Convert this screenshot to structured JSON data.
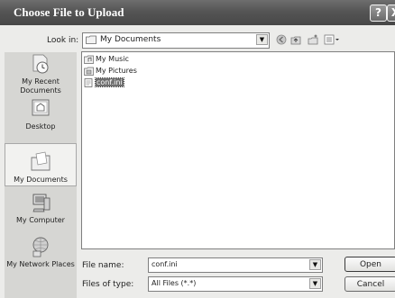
{
  "window": {
    "title": "Choose File to Upload",
    "help_glyph": "?",
    "close_glyph": "X"
  },
  "lookin": {
    "label": "Look in:",
    "value": "My Documents"
  },
  "toolbar": [
    "back-icon",
    "up-folder-icon",
    "new-folder-icon",
    "views-menu-icon"
  ],
  "places": [
    {
      "label": "My Recent Documents",
      "icon": "recent-documents-icon"
    },
    {
      "label": "Desktop",
      "icon": "desktop-icon"
    },
    {
      "label": "My Documents",
      "icon": "my-documents-icon",
      "selected": true
    },
    {
      "label": "My Computer",
      "icon": "my-computer-icon"
    },
    {
      "label": "My Network Places",
      "icon": "network-places-icon"
    }
  ],
  "files": [
    {
      "name": "My Music",
      "icon": "folder-music-icon"
    },
    {
      "name": "My Pictures",
      "icon": "folder-pictures-icon"
    },
    {
      "name": "conf.ini",
      "icon": "ini-file-icon",
      "selected": true
    }
  ],
  "filename": {
    "label": "File name:",
    "value": "conf.ini"
  },
  "filetype": {
    "label": "Files of type:",
    "value": "All Files (*.*)"
  },
  "buttons": {
    "open": "Open",
    "cancel": "Cancel"
  }
}
